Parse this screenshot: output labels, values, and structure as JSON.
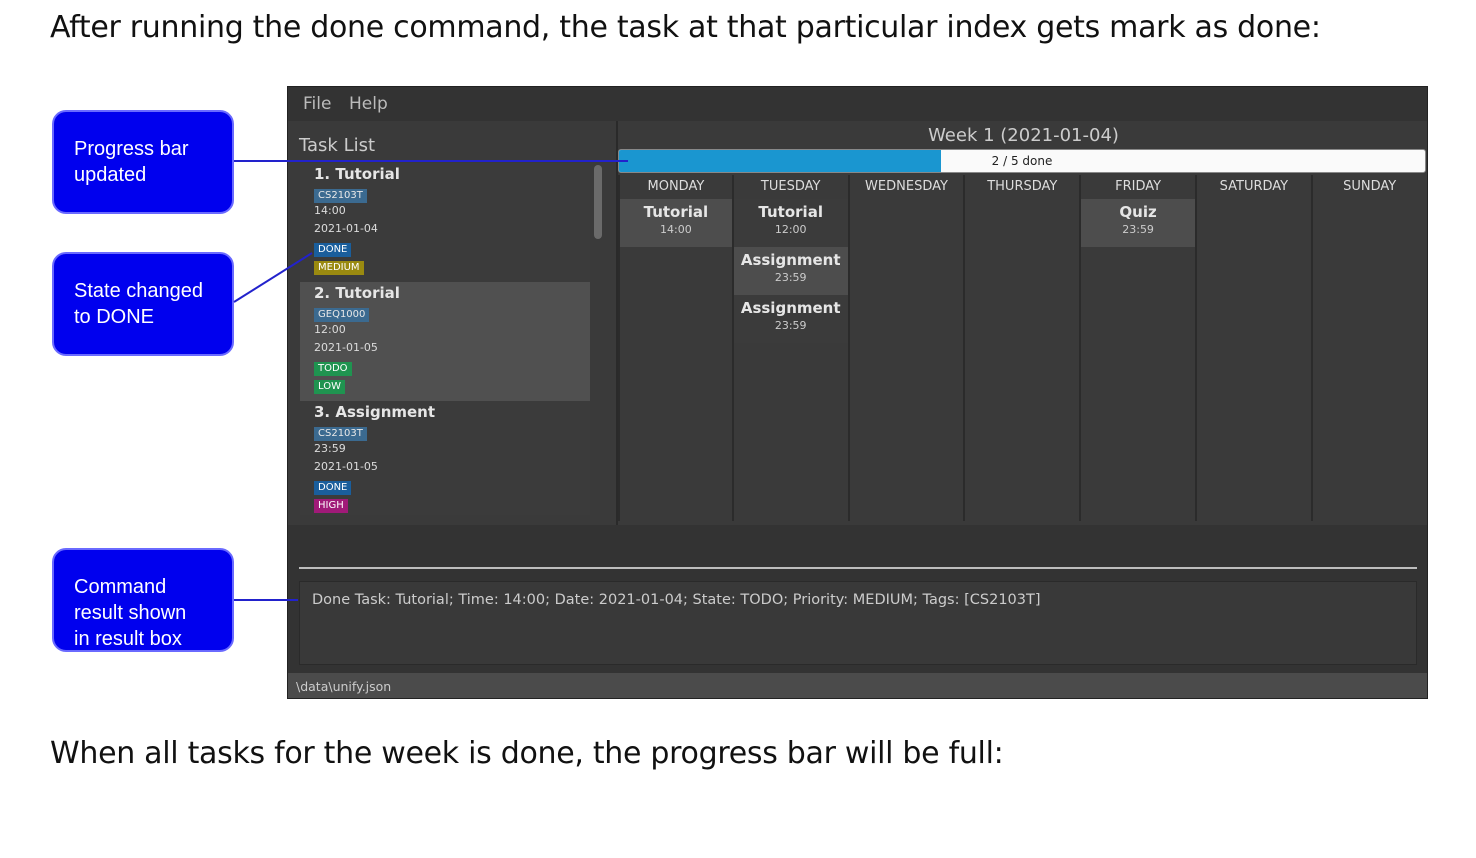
{
  "captions": {
    "top": "After running the done command, the task at that particular index gets mark as done:",
    "bottom": "When all tasks for the week is done, the progress bar will be full:"
  },
  "callouts": {
    "progress": [
      "Progress bar",
      "updated"
    ],
    "state": [
      "State changed",
      "to DONE"
    ],
    "result": [
      "Command",
      "result shown",
      "in result box"
    ]
  },
  "app": {
    "menu": {
      "file": "File",
      "help": "Help"
    },
    "task_list_title": "Task List",
    "tasks": [
      {
        "name": "1.  Tutorial",
        "tag": "CS2103T",
        "time": "14:00",
        "date": "2021-01-04",
        "state": "DONE",
        "priority": "MEDIUM"
      },
      {
        "name": "2.  Tutorial",
        "tag": "GEQ1000",
        "time": "12:00",
        "date": "2021-01-05",
        "state": "TODO",
        "priority": "LOW"
      },
      {
        "name": "3.  Assignment",
        "tag": "CS2103T",
        "time": "23:59",
        "date": "2021-01-05",
        "state": "DONE",
        "priority": "HIGH"
      }
    ],
    "week_title": "Week 1 (2021-01-04)",
    "progress": {
      "label": "2 / 5 done",
      "fraction": 0.4
    },
    "days": [
      {
        "name": "MONDAY",
        "tasks": [
          {
            "name": "Tutorial",
            "time": "14:00"
          }
        ]
      },
      {
        "name": "TUESDAY",
        "tasks": [
          {
            "name": "Tutorial",
            "time": "12:00"
          },
          {
            "name": "Assignment",
            "time": "23:59"
          },
          {
            "name": "Assignment",
            "time": "23:59"
          }
        ]
      },
      {
        "name": "WEDNESDAY",
        "tasks": []
      },
      {
        "name": "THURSDAY",
        "tasks": []
      },
      {
        "name": "FRIDAY",
        "tasks": [
          {
            "name": "Quiz",
            "time": "23:59"
          }
        ]
      },
      {
        "name": "SATURDAY",
        "tasks": []
      },
      {
        "name": "SUNDAY",
        "tasks": []
      }
    ],
    "command_input": "",
    "result_text": "Done Task: Tutorial; Time: 14:00; Date: 2021-01-04; State: TODO; Priority: MEDIUM; Tags: [CS2103T]",
    "status_path": "\\data\\unify.json"
  },
  "colors": {
    "callout_bg": "#0000ee",
    "progress_fill": "#1a96d0",
    "state_done": "#1a5e9c",
    "state_todo": "#1f9450",
    "priority_medium": "#9a8a10",
    "priority_low": "#1f9450",
    "priority_high": "#a01a78"
  }
}
